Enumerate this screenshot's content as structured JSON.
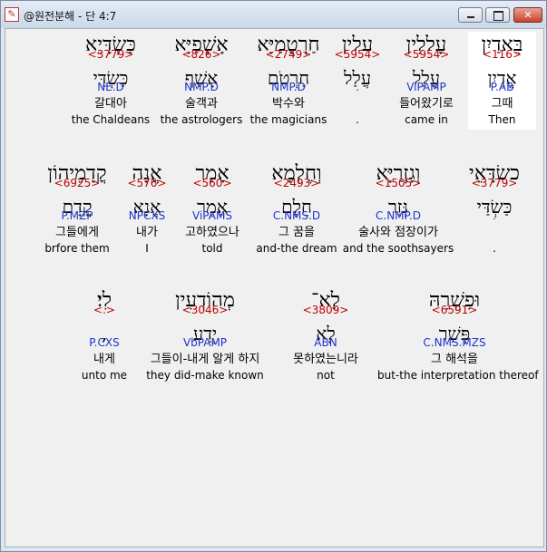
{
  "window": {
    "title": "@원전분해 - 단 4:7",
    "app_icon": "app-logo-icon"
  },
  "controls": {
    "minimize": "minimize-icon",
    "maximize": "maximize-icon",
    "close": "close-icon"
  },
  "rows": [
    [
      {
        "hebrew": "בֵּאדַיִן",
        "number": "<116>",
        "lemma": "אֱדַיִן",
        "code": "P.AB",
        "korean": "그때",
        "english": "Then",
        "highlight": true
      },
      {
        "hebrew": "עָלִלִין",
        "number": "<5954>",
        "lemma": "עֲלַל",
        "code": "ViPAMP",
        "korean": "들어왔기로",
        "english": "came in"
      },
      {
        "hebrew": "עלין",
        "number": "<5954>",
        "lemma": "עֲלַל",
        "code": ".",
        "korean": "",
        "english": "."
      },
      {
        "hebrew": "חַרְטֻמַיָּא",
        "number": "<2749>",
        "lemma": "חַרְטֹם",
        "code": "NMP.D",
        "korean": "박수와",
        "english": "the magicians"
      },
      {
        "hebrew": "אָשְׁפַיָּא",
        "number": "<826>",
        "lemma": "אָשַׁף",
        "code": "NMP.D",
        "korean": "술객과",
        "english": "the astrologers"
      },
      {
        "hebrew": "כַּשְׂדָּיֵא",
        "number": "<3779>",
        "lemma": "כַּשְׂדַּי",
        "code": "NE.D",
        "korean": "갈대아",
        "english": "the Chaldeans"
      }
    ],
    [
      {
        "hebrew": "כשׂדָּאֵי",
        "number": "<3779>",
        "lemma": "כַּשְׂדַּי",
        "code": ".",
        "korean": "",
        "english": "."
      },
      {
        "hebrew": "וְגָזְרַיָּא",
        "number": "<1505>",
        "lemma": "גְּזַר",
        "code": "C.NMP.D",
        "korean": "술사와 점장이가",
        "english": "and the soothsayers"
      },
      {
        "hebrew": "וְחֶלְמָא",
        "number": "<2493>",
        "lemma": "חֵלֶם",
        "code": "C.NMS.D",
        "korean": "그 꿈을",
        "english": "and-the dream"
      },
      {
        "hebrew": "אָמַר",
        "number": "<560>",
        "lemma": "אֲמַר",
        "code": "ViPAMS",
        "korean": "고하였으나",
        "english": "told"
      },
      {
        "hebrew": "אֲנָה",
        "number": "<576>",
        "lemma": "אֲנָא",
        "code": "NPCXS",
        "korean": "내가",
        "english": "I"
      },
      {
        "hebrew": "קֳדָמֵיהוֹן",
        "number": "<6925>",
        "lemma": "קֳדָם",
        "code": "P.MZP",
        "korean": "그들에게",
        "english": "brfore them"
      }
    ],
    [
      {
        "hebrew": "וּפִשְׁרֵהּ",
        "number": "<6591>",
        "lemma": "פְּשַׁר",
        "code": "C.NMS.MZS",
        "korean": "그 해석을",
        "english": "but-the interpretation thereof"
      },
      {
        "hebrew": "לָא־",
        "number": "<3809>",
        "lemma": "לָא",
        "code": "ABN",
        "korean": "못하였는니라",
        "english": "not"
      },
      {
        "hebrew": "מְהוֹדְעִין",
        "number": "<3046>",
        "lemma": "יְדַע",
        "code": "VbPAMP",
        "korean": "그들이-내게 알게 하지",
        "english": "they did-make known"
      },
      {
        "hebrew": "לִי׃",
        "number": "<.>",
        "lemma": ",",
        "code": "P.CXS",
        "korean": "내게",
        "english": "unto me"
      }
    ]
  ]
}
